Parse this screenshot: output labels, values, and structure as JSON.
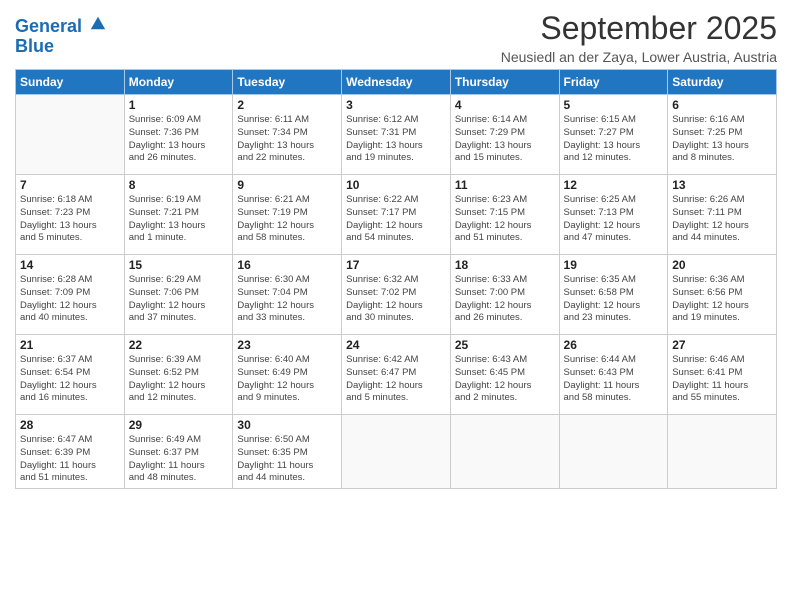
{
  "logo": {
    "line1": "General",
    "line2": "Blue"
  },
  "title": "September 2025",
  "subtitle": "Neusiedl an der Zaya, Lower Austria, Austria",
  "days_of_week": [
    "Sunday",
    "Monday",
    "Tuesday",
    "Wednesday",
    "Thursday",
    "Friday",
    "Saturday"
  ],
  "weeks": [
    [
      {
        "day": "",
        "info": []
      },
      {
        "day": "1",
        "info": [
          "Sunrise: 6:09 AM",
          "Sunset: 7:36 PM",
          "Daylight: 13 hours",
          "and 26 minutes."
        ]
      },
      {
        "day": "2",
        "info": [
          "Sunrise: 6:11 AM",
          "Sunset: 7:34 PM",
          "Daylight: 13 hours",
          "and 22 minutes."
        ]
      },
      {
        "day": "3",
        "info": [
          "Sunrise: 6:12 AM",
          "Sunset: 7:31 PM",
          "Daylight: 13 hours",
          "and 19 minutes."
        ]
      },
      {
        "day": "4",
        "info": [
          "Sunrise: 6:14 AM",
          "Sunset: 7:29 PM",
          "Daylight: 13 hours",
          "and 15 minutes."
        ]
      },
      {
        "day": "5",
        "info": [
          "Sunrise: 6:15 AM",
          "Sunset: 7:27 PM",
          "Daylight: 13 hours",
          "and 12 minutes."
        ]
      },
      {
        "day": "6",
        "info": [
          "Sunrise: 6:16 AM",
          "Sunset: 7:25 PM",
          "Daylight: 13 hours",
          "and 8 minutes."
        ]
      }
    ],
    [
      {
        "day": "7",
        "info": [
          "Sunrise: 6:18 AM",
          "Sunset: 7:23 PM",
          "Daylight: 13 hours",
          "and 5 minutes."
        ]
      },
      {
        "day": "8",
        "info": [
          "Sunrise: 6:19 AM",
          "Sunset: 7:21 PM",
          "Daylight: 13 hours",
          "and 1 minute."
        ]
      },
      {
        "day": "9",
        "info": [
          "Sunrise: 6:21 AM",
          "Sunset: 7:19 PM",
          "Daylight: 12 hours",
          "and 58 minutes."
        ]
      },
      {
        "day": "10",
        "info": [
          "Sunrise: 6:22 AM",
          "Sunset: 7:17 PM",
          "Daylight: 12 hours",
          "and 54 minutes."
        ]
      },
      {
        "day": "11",
        "info": [
          "Sunrise: 6:23 AM",
          "Sunset: 7:15 PM",
          "Daylight: 12 hours",
          "and 51 minutes."
        ]
      },
      {
        "day": "12",
        "info": [
          "Sunrise: 6:25 AM",
          "Sunset: 7:13 PM",
          "Daylight: 12 hours",
          "and 47 minutes."
        ]
      },
      {
        "day": "13",
        "info": [
          "Sunrise: 6:26 AM",
          "Sunset: 7:11 PM",
          "Daylight: 12 hours",
          "and 44 minutes."
        ]
      }
    ],
    [
      {
        "day": "14",
        "info": [
          "Sunrise: 6:28 AM",
          "Sunset: 7:09 PM",
          "Daylight: 12 hours",
          "and 40 minutes."
        ]
      },
      {
        "day": "15",
        "info": [
          "Sunrise: 6:29 AM",
          "Sunset: 7:06 PM",
          "Daylight: 12 hours",
          "and 37 minutes."
        ]
      },
      {
        "day": "16",
        "info": [
          "Sunrise: 6:30 AM",
          "Sunset: 7:04 PM",
          "Daylight: 12 hours",
          "and 33 minutes."
        ]
      },
      {
        "day": "17",
        "info": [
          "Sunrise: 6:32 AM",
          "Sunset: 7:02 PM",
          "Daylight: 12 hours",
          "and 30 minutes."
        ]
      },
      {
        "day": "18",
        "info": [
          "Sunrise: 6:33 AM",
          "Sunset: 7:00 PM",
          "Daylight: 12 hours",
          "and 26 minutes."
        ]
      },
      {
        "day": "19",
        "info": [
          "Sunrise: 6:35 AM",
          "Sunset: 6:58 PM",
          "Daylight: 12 hours",
          "and 23 minutes."
        ]
      },
      {
        "day": "20",
        "info": [
          "Sunrise: 6:36 AM",
          "Sunset: 6:56 PM",
          "Daylight: 12 hours",
          "and 19 minutes."
        ]
      }
    ],
    [
      {
        "day": "21",
        "info": [
          "Sunrise: 6:37 AM",
          "Sunset: 6:54 PM",
          "Daylight: 12 hours",
          "and 16 minutes."
        ]
      },
      {
        "day": "22",
        "info": [
          "Sunrise: 6:39 AM",
          "Sunset: 6:52 PM",
          "Daylight: 12 hours",
          "and 12 minutes."
        ]
      },
      {
        "day": "23",
        "info": [
          "Sunrise: 6:40 AM",
          "Sunset: 6:49 PM",
          "Daylight: 12 hours",
          "and 9 minutes."
        ]
      },
      {
        "day": "24",
        "info": [
          "Sunrise: 6:42 AM",
          "Sunset: 6:47 PM",
          "Daylight: 12 hours",
          "and 5 minutes."
        ]
      },
      {
        "day": "25",
        "info": [
          "Sunrise: 6:43 AM",
          "Sunset: 6:45 PM",
          "Daylight: 12 hours",
          "and 2 minutes."
        ]
      },
      {
        "day": "26",
        "info": [
          "Sunrise: 6:44 AM",
          "Sunset: 6:43 PM",
          "Daylight: 11 hours",
          "and 58 minutes."
        ]
      },
      {
        "day": "27",
        "info": [
          "Sunrise: 6:46 AM",
          "Sunset: 6:41 PM",
          "Daylight: 11 hours",
          "and 55 minutes."
        ]
      }
    ],
    [
      {
        "day": "28",
        "info": [
          "Sunrise: 6:47 AM",
          "Sunset: 6:39 PM",
          "Daylight: 11 hours",
          "and 51 minutes."
        ]
      },
      {
        "day": "29",
        "info": [
          "Sunrise: 6:49 AM",
          "Sunset: 6:37 PM",
          "Daylight: 11 hours",
          "and 48 minutes."
        ]
      },
      {
        "day": "30",
        "info": [
          "Sunrise: 6:50 AM",
          "Sunset: 6:35 PM",
          "Daylight: 11 hours",
          "and 44 minutes."
        ]
      },
      {
        "day": "",
        "info": []
      },
      {
        "day": "",
        "info": []
      },
      {
        "day": "",
        "info": []
      },
      {
        "day": "",
        "info": []
      }
    ]
  ]
}
